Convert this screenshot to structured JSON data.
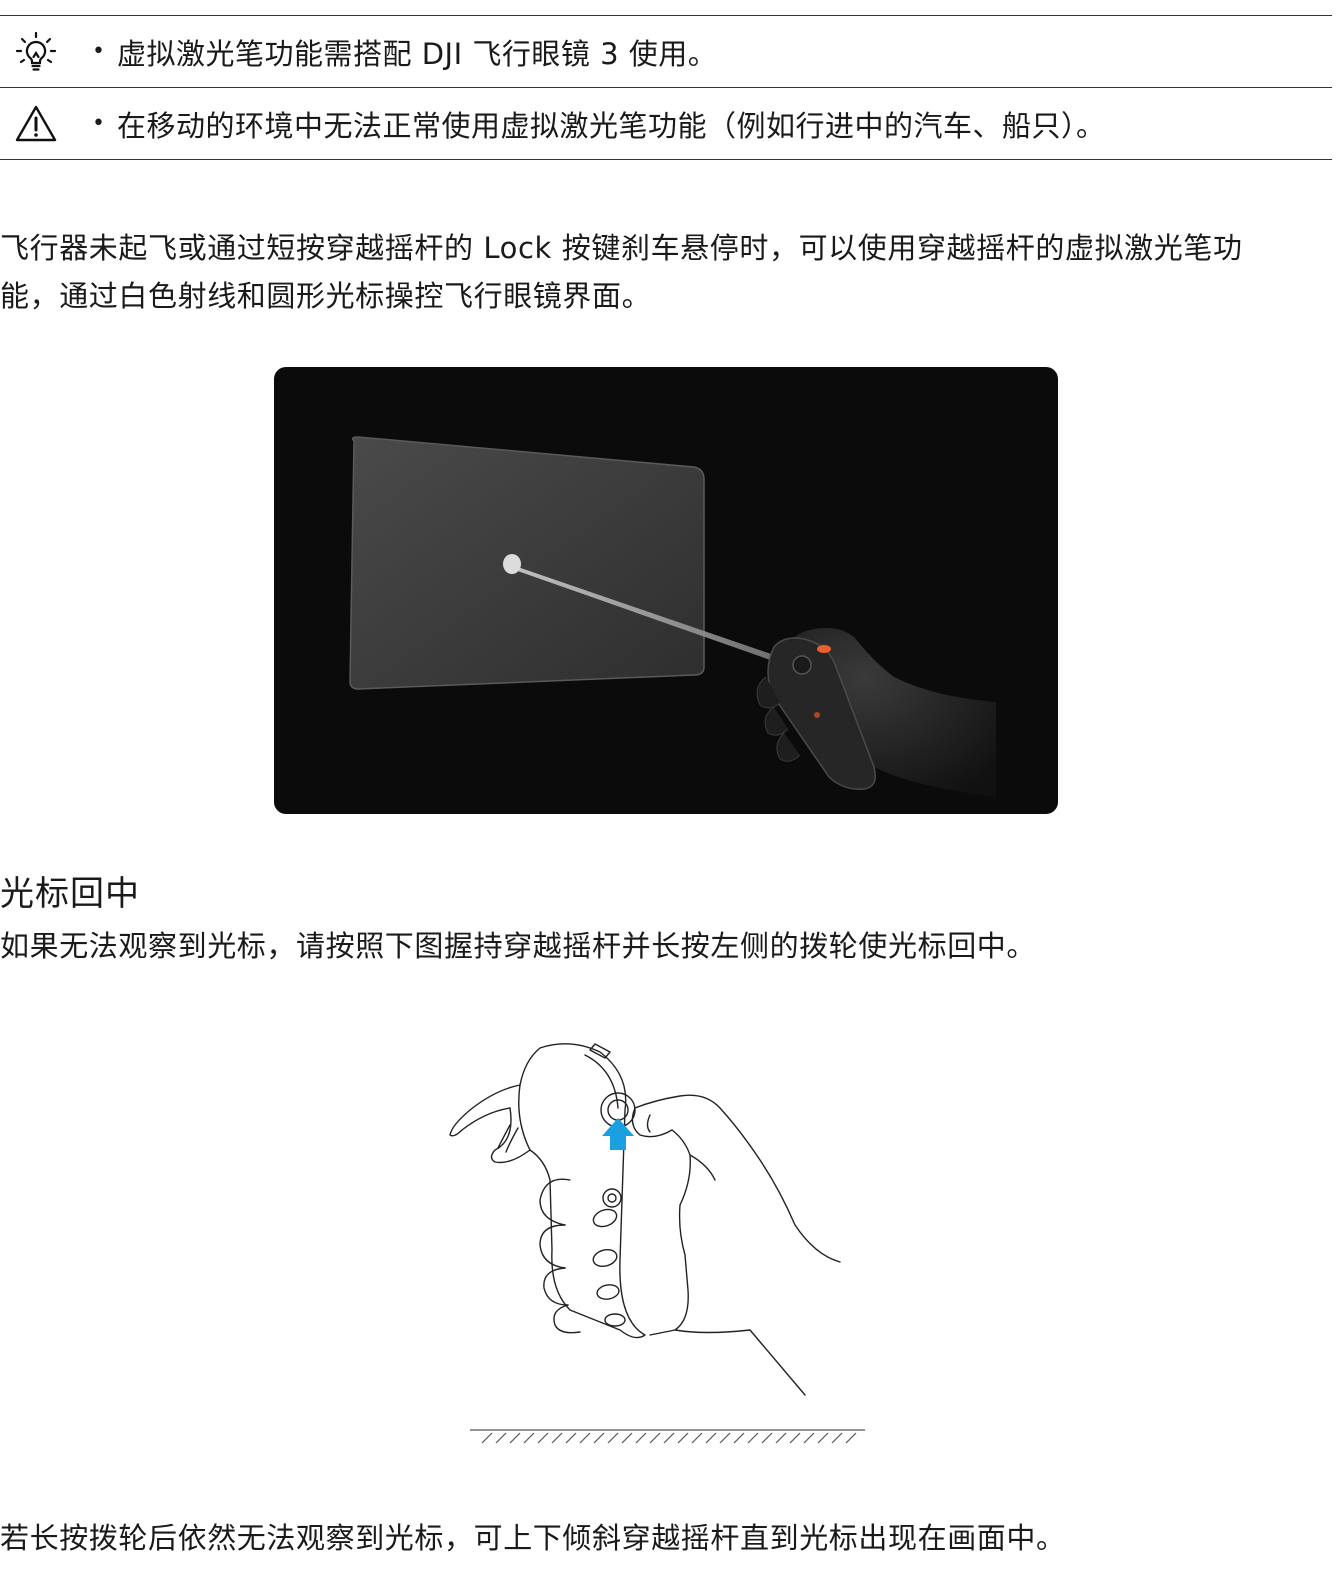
{
  "notes": [
    {
      "icon": "lightbulb-icon",
      "text": "虚拟激光笔功能需搭配 DJI 飞行眼镜 3 使用。"
    },
    {
      "icon": "warning-icon",
      "text": "在移动的环境中无法正常使用虚拟激光笔功能（例如行进中的汽车、船只）。"
    }
  ],
  "paragraph1": {
    "line1": "飞行器未起飞或通过短按穿越摇杆的 Lock 按键刹车悬停时，可以使用穿越摇杆的虚拟激光笔功",
    "line2": "能，通过白色射线和圆形光标操控飞行眼镜界面。"
  },
  "section": {
    "heading": "光标回中",
    "text": "如果无法观察到光标，请按照下图握持穿越摇杆并长按左侧的拨轮使光标回中。"
  },
  "footer_text": "若长按拨轮后依然无法观察到光标，可上下倾斜穿越摇杆直到光标出现在画面中。",
  "colors": {
    "arrow": "#1aa0e0",
    "photo_bg": "#0b0b0b",
    "orange_button": "#e8612c"
  }
}
